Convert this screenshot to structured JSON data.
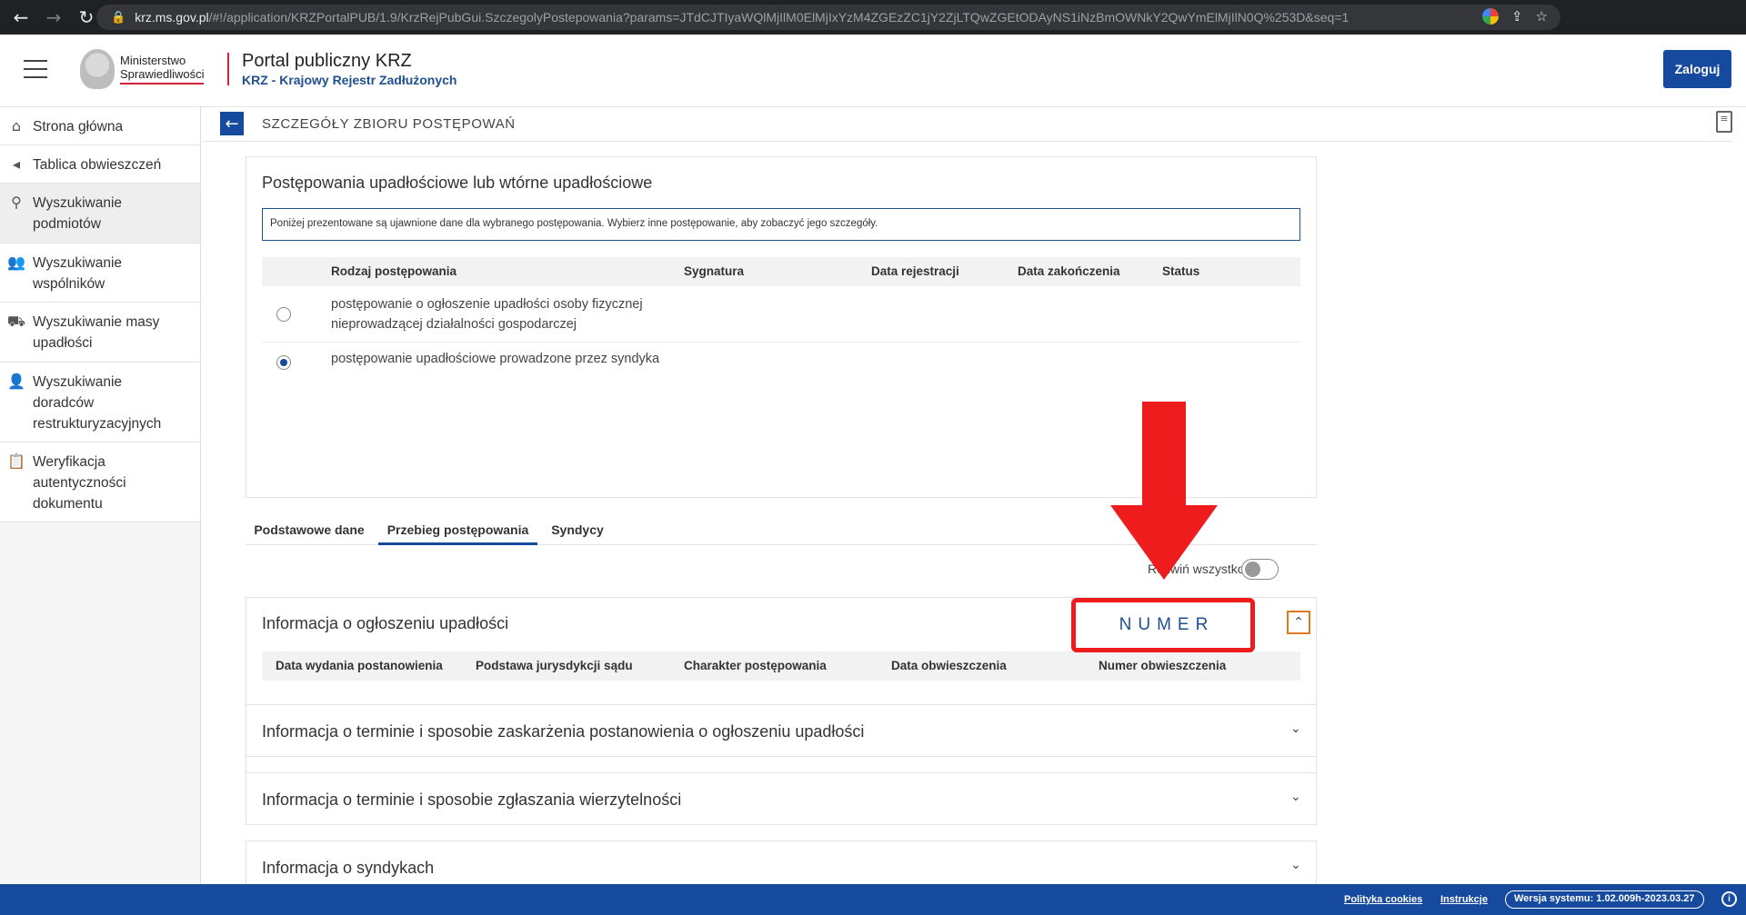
{
  "browser": {
    "url_domain": "krz.ms.gov.pl",
    "url_path": "/#!/application/KRZPortalPUB/1.9/KrzRejPubGui.SzczegolyPostepowania?params=JTdCJTIyaWQlMjIlM0ElMjIxYzM4ZGEzZC1jY2ZjLTQwZGEtODAyNS1iNzBmOWNkY2QwYmElMjIlN0Q%253D&seq=1"
  },
  "header": {
    "ministry_line1": "Ministerstwo",
    "ministry_line2": "Sprawiedliwości",
    "portal_title": "Portal publiczny KRZ",
    "portal_subtitle": "KRZ - Krajowy Rejestr Zadłużonych",
    "login_label": "Zaloguj"
  },
  "sidebar": {
    "items": [
      {
        "label": "Strona główna",
        "icon": "home-icon"
      },
      {
        "label": "Tablica obwieszczeń",
        "icon": "megaphone-icon"
      },
      {
        "label": "Wyszukiwanie podmiotów",
        "icon": "person-search-icon"
      },
      {
        "label": "Wyszukiwanie wspólników",
        "icon": "people-icon"
      },
      {
        "label": "Wyszukiwanie masy upadłości",
        "icon": "car-icon"
      },
      {
        "label": "Wyszukiwanie doradców restrukturyzacyjnych",
        "icon": "person-add-icon"
      },
      {
        "label": "Weryfikacja autentyczności dokumentu",
        "icon": "clipboard-check-icon"
      }
    ]
  },
  "page": {
    "title": "SZCZEGÓŁY ZBIORU POSTĘPOWAŃ"
  },
  "proceedings": {
    "title": "Postępowania upadłościowe lub wtórne upadłościowe",
    "info": "Poniżej prezentowane są ujawnione dane dla wybranego postępowania. Wybierz inne postępowanie, aby zobaczyć jego szczegóły.",
    "columns": [
      "Rodzaj postępowania",
      "Sygnatura",
      "Data rejestracji",
      "Data zakończenia",
      "Status"
    ],
    "rows": [
      {
        "type_line1": "postępowanie o ogłoszenie upadłości osoby fizycznej",
        "type_line2": "nieprowadzącej działalności gospodarczej",
        "selected": false
      },
      {
        "type_line1": "postępowanie upadłościowe prowadzone przez syndyka",
        "type_line2": "",
        "selected": true
      }
    ]
  },
  "tabs": [
    "Podstawowe dane",
    "Przebieg postępowania",
    "Syndycy"
  ],
  "expand_all_label": "Rozwiń wszystko",
  "sections": {
    "bankruptcy_info": {
      "title": "Informacja o ogłoszeniu upadłości",
      "columns": [
        "Data wydania postanowienia",
        "Podstawa jurysdykcji sądu",
        "Charakter postępowania",
        "Data obwieszczenia",
        "Numer obwieszczenia"
      ]
    },
    "collapsed": [
      "Informacja o terminie i sposobie zaskarżenia postanowienia o ogłoszeniu upadłości",
      "Informacja o terminie i sposobie zgłaszania wierzytelności",
      "Informacja o syndykach"
    ]
  },
  "annotation": {
    "label": "NUMER",
    "color": "#ee1c1c"
  },
  "footer": {
    "policy_label": "Polityka cookies",
    "instructions_label": "Instrukcje",
    "version_label": "Wersja systemu: 1.02.009h-2023.03.27"
  },
  "colors": {
    "brand_blue": "#164a9e",
    "accent_red": "#d4213d",
    "collapse_orange": "#e07820"
  }
}
